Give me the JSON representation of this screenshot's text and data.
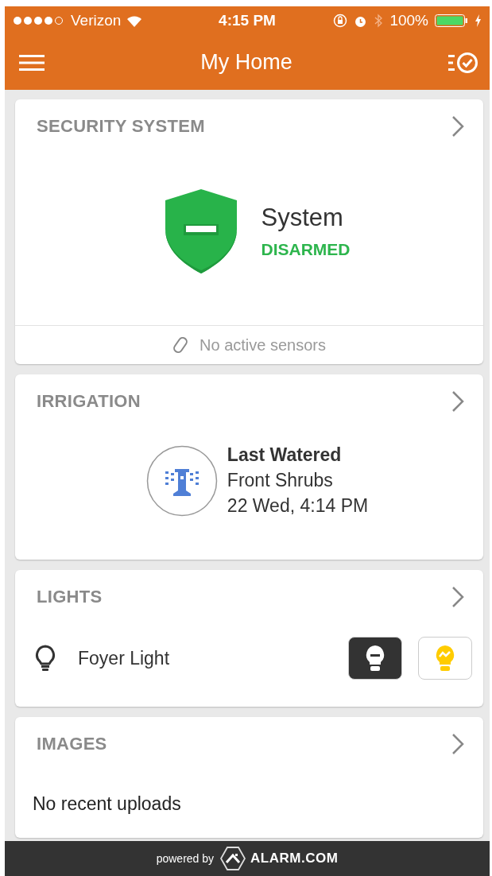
{
  "status_bar": {
    "carrier": "Verizon",
    "time": "4:15 PM",
    "battery": "100%"
  },
  "nav": {
    "title": "My Home"
  },
  "security": {
    "title": "SECURITY SYSTEM",
    "label": "System",
    "status": "DISARMED",
    "sensors": "No active sensors"
  },
  "irrigation": {
    "title": "IRRIGATION",
    "heading": "Last Watered",
    "zone": "Front Shrubs",
    "time": "22 Wed, 4:14 PM"
  },
  "lights": {
    "title": "LIGHTS",
    "items": [
      {
        "name": "Foyer Light",
        "switch": [
          {
            "kind": "off",
            "selected": true
          },
          {
            "kind": "on",
            "selected": false
          }
        ]
      }
    ]
  },
  "images": {
    "title": "IMAGES",
    "message": "No recent uploads"
  },
  "footer": {
    "prefix": "powered by",
    "brand": "ALARM.COM"
  }
}
